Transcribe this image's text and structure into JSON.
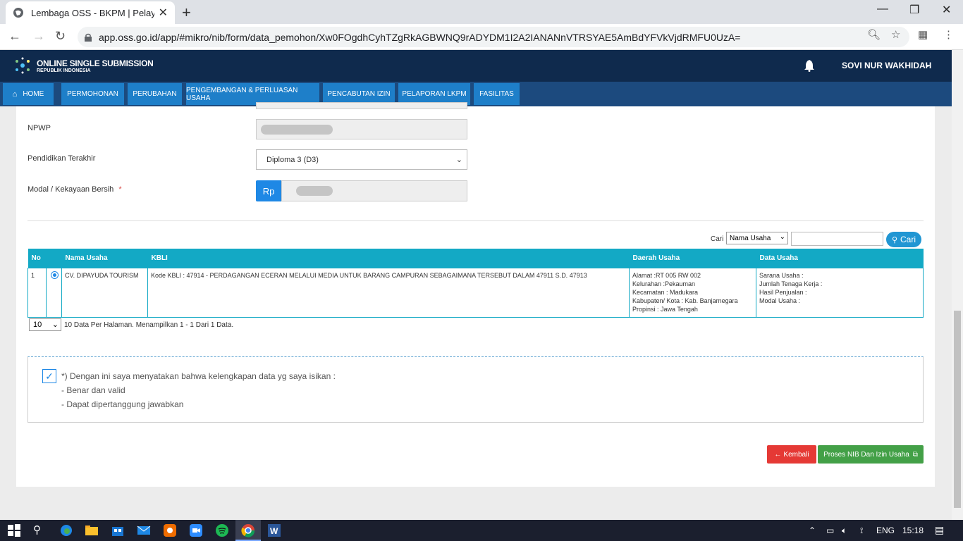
{
  "browser": {
    "tab_title": "Lembaga OSS - BKPM | Pelayanan",
    "url": "app.oss.go.id/app/#mikro/nib/form/data_pemohon/Xw0FOgdhCyhTZgRkAGBWNQ9rADYDM1I2A2IANANnVTRSYAE5AmBdYFVkVjdRMFU0UzA="
  },
  "header": {
    "logo_title": "ONLINE SINGLE SUBMISSION",
    "logo_sub": "REPUBLIK INDONESIA",
    "user_name": "SOVI NUR WAKHIDAH"
  },
  "menu": [
    {
      "label": "HOME"
    },
    {
      "label": "PERMOHONAN"
    },
    {
      "label": "PERUBAHAN"
    },
    {
      "label": "PENGEMBANGAN & PERLUASAN USAHA"
    },
    {
      "label": "PENCABUTAN IZIN"
    },
    {
      "label": "PELAPORAN LKPM"
    },
    {
      "label": "FASILITAS"
    }
  ],
  "form": {
    "npwp_label": "NPWP",
    "pendidikan_label": "Pendidikan Terakhir",
    "pendidikan_value": "Diploma 3 (D3)",
    "modal_label": "Modal / Kekayaan Bersih",
    "required_mark": "*",
    "currency": "Rp"
  },
  "search": {
    "label": "Cari",
    "field_value": "Nama Usaha",
    "button": "Cari"
  },
  "table": {
    "headers": [
      "No",
      "Nama Usaha",
      "KBLI",
      "Daerah Usaha",
      "Data Usaha"
    ],
    "row": {
      "no": "1",
      "nama": "CV. DIPAYUDA TOURISM",
      "kbli": "Kode KBLI : 47914 - PERDAGANGAN ECERAN MELALUI MEDIA UNTUK BARANG CAMPURAN SEBAGAIMANA TERSEBUT DALAM 47911 S.D. 47913",
      "daerah": [
        "Alamat :RT 005 RW 002",
        "Kelurahan :Pekauman",
        "Kecamatan : Madukara",
        "Kabupaten/ Kota : Kab. Banjarnegara",
        "Propinsi : Jawa Tengah"
      ],
      "data_usaha": [
        "Sarana Usaha :",
        "Jumlah Tenaga Kerja :",
        "Hasil Penjualan :",
        "Modal Usaha :"
      ]
    }
  },
  "pager": {
    "per_page": "10",
    "text": "10 Data Per Halaman. Menampilkan 1 - 1 Dari 1 Data."
  },
  "confirm": {
    "line1": "*) Dengan ini saya menyatakan bahwa kelengkapan data yg saya isikan :",
    "line2": "- Benar dan valid",
    "line3": "- Dapat dipertanggung jawabkan"
  },
  "buttons": {
    "back": "Kembali",
    "proses": "Proses NIB Dan Izin Usaha"
  },
  "taskbar": {
    "lang": "ENG",
    "time": "15:18"
  },
  "colors": {
    "header_bg": "#0f2a4d",
    "menu_item": "#1e7fc9",
    "table_header": "#13a9c5",
    "back_btn": "#e53935",
    "proses_btn": "#43a047"
  }
}
